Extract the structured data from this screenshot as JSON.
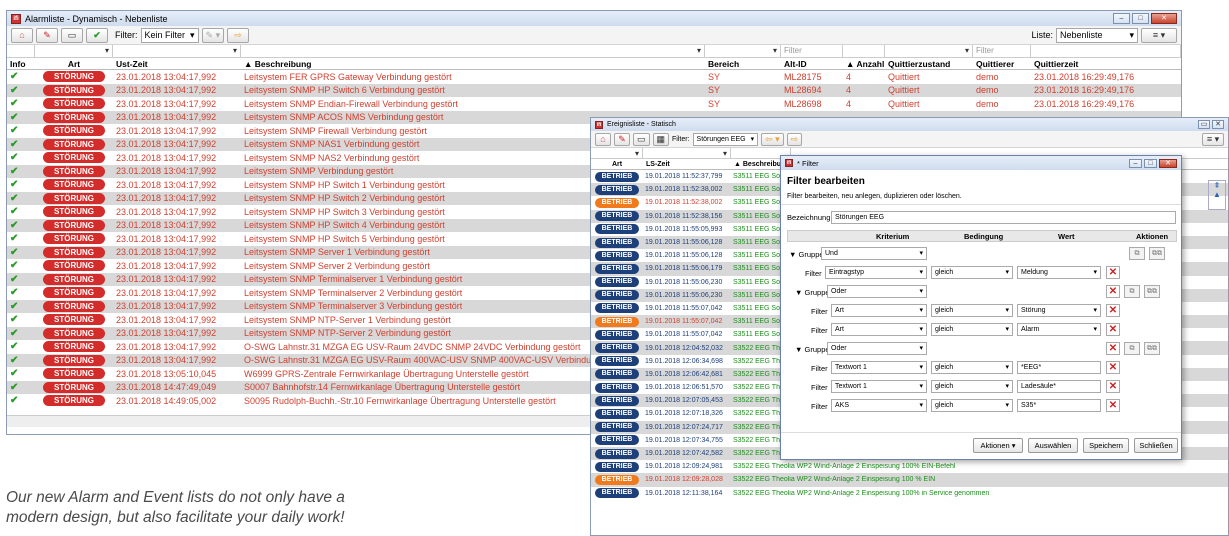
{
  "alarm": {
    "title": "Alarmliste - Dynamisch - Nebenliste",
    "filter_label": "Filter:",
    "filter_value": "Kein Filter",
    "list_label": "Liste:",
    "list_value": "Nebenliste",
    "filter_placeholder": "Filter",
    "headers": [
      "Info",
      "Art",
      "Ust-Zeit",
      "Beschreibung",
      "Bereich",
      "Alt-ID",
      "Anzahl",
      "Quittierzustand",
      "Quittierer",
      "Quittierzeit"
    ],
    "rows": [
      {
        "t": "23.01.2018 13:04:17,992",
        "d": "Leitsystem FER GPRS Gateway Verbindung gestört",
        "b": "SY",
        "id": "ML28175",
        "n": "4",
        "q": "Quittiert",
        "u": "demo",
        "qz": "23.01.2018 16:29:49,176"
      },
      {
        "t": "23.01.2018 13:04:17,992",
        "d": "Leitsystem SNMP HP Switch 6 Verbindung gestört",
        "b": "SY",
        "id": "ML28694",
        "n": "4",
        "q": "Quittiert",
        "u": "demo",
        "qz": "23.01.2018 16:29:49,176"
      },
      {
        "t": "23.01.2018 13:04:17,992",
        "d": "Leitsystem SNMP Endian-Firewall Verbindung gestört",
        "b": "SY",
        "id": "ML28698",
        "n": "4",
        "q": "Quittiert",
        "u": "demo",
        "qz": "23.01.2018 16:29:49,176"
      },
      {
        "t": "23.01.2018 13:04:17,992",
        "d": "Leitsystem SNMP ACOS NMS Verbindung gestört"
      },
      {
        "t": "23.01.2018 13:04:17,992",
        "d": "Leitsystem SNMP Firewall Verbindung gestört"
      },
      {
        "t": "23.01.2018 13:04:17,992",
        "d": "Leitsystem SNMP NAS1 Verbindung gestört"
      },
      {
        "t": "23.01.2018 13:04:17,992",
        "d": "Leitsystem SNMP NAS2 Verbindung gestört"
      },
      {
        "t": "23.01.2018 13:04:17,992",
        "d": "Leitsystem SNMP Verbindung gestört"
      },
      {
        "t": "23.01.2018 13:04:17,992",
        "d": "Leitsystem SNMP HP Switch 1 Verbindung gestört"
      },
      {
        "t": "23.01.2018 13:04:17,992",
        "d": "Leitsystem SNMP HP Switch 2 Verbindung gestört"
      },
      {
        "t": "23.01.2018 13:04:17,992",
        "d": "Leitsystem SNMP HP Switch 3 Verbindung gestört"
      },
      {
        "t": "23.01.2018 13:04:17,992",
        "d": "Leitsystem SNMP HP Switch 4 Verbindung gestört"
      },
      {
        "t": "23.01.2018 13:04:17,992",
        "d": "Leitsystem SNMP HP Switch 5 Verbindung gestört"
      },
      {
        "t": "23.01.2018 13:04:17,992",
        "d": "Leitsystem SNMP Server 1 Verbindung gestört"
      },
      {
        "t": "23.01.2018 13:04:17,992",
        "d": "Leitsystem SNMP Server 2 Verbindung gestört"
      },
      {
        "t": "23.01.2018 13:04:17,992",
        "d": "Leitsystem SNMP Terminalserver 1 Verbindung gestört"
      },
      {
        "t": "23.01.2018 13:04:17,992",
        "d": "Leitsystem SNMP Terminalserver 2 Verbindung gestört"
      },
      {
        "t": "23.01.2018 13:04:17,992",
        "d": "Leitsystem SNMP Terminalserver 3 Verbindung gestört"
      },
      {
        "t": "23.01.2018 13:04:17,992",
        "d": "Leitsystem SNMP NTP-Server 1 Verbindung gestört"
      },
      {
        "t": "23.01.2018 13:04:17,992",
        "d": "Leitsystem SNMP NTP-Server 2 Verbindung gestört"
      },
      {
        "t": "23.01.2018 13:04:17,992",
        "d": "O-SWG Lahnstr.31 MZGA EG USV-Raum 24VDC SNMP 24VDC Verbindung gestört"
      },
      {
        "t": "23.01.2018 13:04:17,992",
        "d": "O-SWG Lahnstr.31 MZGA EG USV-Raum 400VAC-USV SNMP 400VAC-USV Verbindung gestört"
      },
      {
        "t": "23.01.2018 13:05:10,045",
        "d": "W6999 GPRS-Zentrale Fernwirkanlage Übertragung Unterstelle gestört"
      },
      {
        "t": "23.01.2018 14:47:49,049",
        "d": "S0007 Bahnhofstr.14 Fernwirkanlage Übertragung Unterstelle gestört"
      },
      {
        "t": "23.01.2018 14:49:05,002",
        "d": "S0095 Rudolph-Buchh.-Str.10 Fernwirkanlage Übertragung Unterstelle gestört"
      }
    ],
    "badge": "STÖRUNG"
  },
  "event": {
    "title": "Ereignisliste - Statisch",
    "filter_label": "Filter:",
    "filter_value": "Störungen EEG",
    "headers": [
      "Art",
      "LS-Zeit",
      "Beschreibung"
    ],
    "rows": [
      {
        "a": "BETRIEB",
        "t": "19.01.2018 11:52:37,799",
        "d": "S3511 EEG Son",
        "c": "b"
      },
      {
        "a": "BETRIEB",
        "t": "19.01.2018 11:52:38,002",
        "d": "S3511 EEG Son",
        "c": "b"
      },
      {
        "a": "BETRIEB",
        "t": "19.01.2018 11:52:38,002",
        "d": "S3511 EEG Son",
        "c": "o"
      },
      {
        "a": "BETRIEB",
        "t": "19.01.2018 11:52:38,156",
        "d": "S3511 EEG Son",
        "c": "b"
      },
      {
        "a": "BETRIEB",
        "t": "19.01.2018 11:55:05,993",
        "d": "S3511 EEG Son",
        "c": "b"
      },
      {
        "a": "BETRIEB",
        "t": "19.01.2018 11:55:06,128",
        "d": "S3511 EEG Son",
        "c": "b"
      },
      {
        "a": "BETRIEB",
        "t": "19.01.2018 11:55:06,128",
        "d": "S3511 EEG Son",
        "c": "b"
      },
      {
        "a": "BETRIEB",
        "t": "19.01.2018 11:55:06,179",
        "d": "S3511 EEG Son",
        "c": "b"
      },
      {
        "a": "BETRIEB",
        "t": "19.01.2018 11:55:06,230",
        "d": "S3511 EEG Son",
        "c": "b"
      },
      {
        "a": "BETRIEB",
        "t": "19.01.2018 11:55:06,230",
        "d": "S3511 EEG Son",
        "c": "b"
      },
      {
        "a": "BETRIEB",
        "t": "19.01.2018 11:55:07,042",
        "d": "S3511 EEG Son",
        "c": "b"
      },
      {
        "a": "BETRIEB",
        "t": "19.01.2018 11:55:07,042",
        "d": "S3511 EEG Son",
        "c": "o"
      },
      {
        "a": "BETRIEB",
        "t": "19.01.2018 11:55:07,042",
        "d": "S3511 EEG Son",
        "c": "b"
      },
      {
        "a": "BETRIEB",
        "t": "19.01.2018 12:04:52,032",
        "d": "S3522 EEG The",
        "c": "b"
      },
      {
        "a": "BETRIEB",
        "t": "19.01.2018 12:06:34,698",
        "d": "S3522 EEG The",
        "c": "b"
      },
      {
        "a": "BETRIEB",
        "t": "19.01.2018 12:06:42,681",
        "d": "S3522 EEG The",
        "c": "b"
      },
      {
        "a": "BETRIEB",
        "t": "19.01.2018 12:06:51,570",
        "d": "S3522 EEG The",
        "c": "b"
      },
      {
        "a": "BETRIEB",
        "t": "19.01.2018 12:07:05,453",
        "d": "S3522 EEG The",
        "c": "b"
      },
      {
        "a": "BETRIEB",
        "t": "19.01.2018 12:07:18,326",
        "d": "S3522 EEG The",
        "c": "b"
      },
      {
        "a": "BETRIEB",
        "t": "19.01.2018 12:07:24,717",
        "d": "S3522 EEG The",
        "c": "b"
      },
      {
        "a": "BETRIEB",
        "t": "19.01.2018 12:07:34,755",
        "d": "S3522 EEG Theolia WP2 Wind-Anlage 2 Einspeisung 30% EIN-Befehl",
        "c": "b"
      },
      {
        "a": "BETRIEB",
        "t": "19.01.2018 12:07:42,582",
        "d": "S3522 EEG Theolia WP2 Wind-Anlage 2 Einspeisung 60% EIN-Befehl",
        "c": "b"
      },
      {
        "a": "BETRIEB",
        "t": "19.01.2018 12:09:24,981",
        "d": "S3522 EEG Theolia WP2 Wind-Anlage 2 Einspeisung 100% EIN-Befehl",
        "c": "b"
      },
      {
        "a": "BETRIEB",
        "t": "19.01.2018 12:09:28,028",
        "d": "S3522 EEG Theolia WP2 Wind-Anlage 2 Einspeisung 100 % EIN",
        "c": "o"
      },
      {
        "a": "BETRIEB",
        "t": "19.01.2018 12:11:38,164",
        "d": "S3522 EEG Theolia WP2 Wind-Anlage 2 Einspeisung 100% in Service genommen",
        "c": "b"
      }
    ]
  },
  "dialog": {
    "title": "* Filter",
    "heading": "Filter bearbeiten",
    "sub": "Filter bearbeiten, neu anlegen, duplizieren oder löschen.",
    "name_label": "Bezeichnung",
    "name_value": "Störungen EEG",
    "cols": [
      "Kriterium",
      "Bedingung",
      "Wert",
      "Aktionen"
    ],
    "group_label": "Gruppe",
    "filter_label": "Filter",
    "und": "Und",
    "oder": "Oder",
    "eintragstyp": "Eintragstyp",
    "art": "Art",
    "textwort": "Textwort 1",
    "aks": "AKS",
    "gleich": "gleich",
    "meldung": "Meldung",
    "stoerung": "Störung",
    "alarm": "Alarm",
    "eeg": "*EEG*",
    "ladesaeule": "Ladesäule*",
    "s35": "S35*",
    "btn_actions": "Aktionen",
    "btn_select": "Auswählen",
    "btn_save": "Speichern",
    "btn_close": "Schließen"
  },
  "caption": {
    "line1": "Our new Alarm and Event lists do not only have a",
    "line2": "modern design, but also facilitate your daily work!"
  }
}
